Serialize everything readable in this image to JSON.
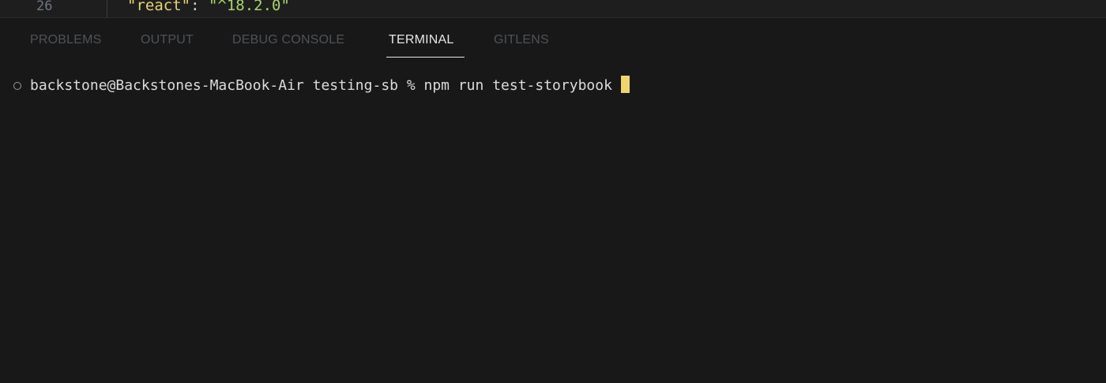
{
  "editor": {
    "line_number": "26",
    "code": {
      "key": "\"react\"",
      "colon": ": ",
      "value": "\"^18.2.0\""
    }
  },
  "panel": {
    "tabs": [
      {
        "label": "PROBLEMS",
        "active": false
      },
      {
        "label": "OUTPUT",
        "active": false
      },
      {
        "label": "DEBUG CONSOLE",
        "active": false
      },
      {
        "label": "TERMINAL",
        "active": true
      },
      {
        "label": "GITLENS",
        "active": false
      }
    ]
  },
  "terminal": {
    "prompt": "backstone@Backstones-MacBook-Air testing-sb % ",
    "command": "npm run test-storybook "
  },
  "colors": {
    "background": "#181818",
    "tab_active": "#e7e7e7",
    "tab_inactive": "#4f5257",
    "cursor": "#f0d56a",
    "json_key": "#e8d56f",
    "json_string": "#a8d66a"
  }
}
